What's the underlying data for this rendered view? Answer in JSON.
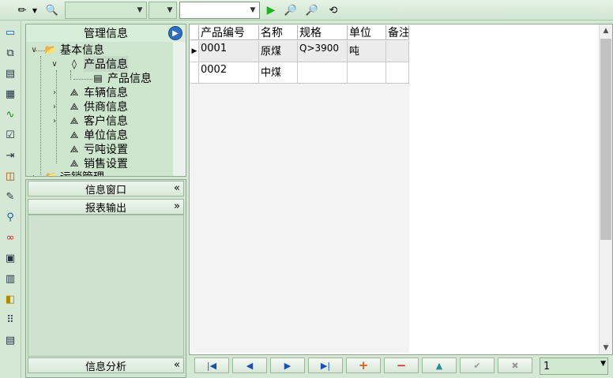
{
  "tree": {
    "header": "管理信息",
    "items": [
      {
        "label": "基本信息"
      },
      {
        "label": "产品信息"
      },
      {
        "label": "产品信息"
      },
      {
        "label": "车辆信息"
      },
      {
        "label": "供商信息"
      },
      {
        "label": "客户信息"
      },
      {
        "label": "单位信息"
      },
      {
        "label": "亏吨设置"
      },
      {
        "label": "销售设置"
      },
      {
        "label": "运销管理"
      }
    ]
  },
  "lower_panel": {
    "info_window": "信息窗口",
    "report_output": "报表输出",
    "info_analysis": "信息分析"
  },
  "grid": {
    "columns": [
      "产品编号",
      "名称",
      "规格",
      "单位",
      "备注"
    ],
    "rows": [
      [
        "0001",
        "原煤",
        "Q>3900",
        "吨",
        ""
      ],
      [
        "0002",
        "中煤",
        "",
        "",
        ""
      ]
    ]
  },
  "navigator": {
    "page_value": "1"
  },
  "colors": {
    "accent": "#d4e8d4",
    "go_button": "#2e6fc4",
    "add": "#e05a1e",
    "remove": "#d23a3a",
    "nav": "#1a4fb8"
  }
}
